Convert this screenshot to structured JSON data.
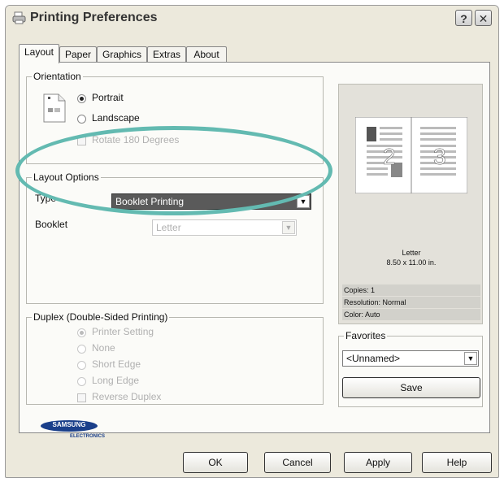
{
  "window": {
    "title": "Printing Preferences",
    "help_glyph": "?",
    "close_glyph": "✕"
  },
  "tabs": [
    {
      "label": "Layout",
      "active": true
    },
    {
      "label": "Paper",
      "active": false
    },
    {
      "label": "Graphics",
      "active": false
    },
    {
      "label": "Extras",
      "active": false
    },
    {
      "label": "About",
      "active": false
    }
  ],
  "orientation": {
    "legend": "Orientation",
    "portrait": "Portrait",
    "landscape": "Landscape",
    "rotate": "Rotate 180 Degrees",
    "selected": "portrait"
  },
  "layout_options": {
    "legend": "Layout Options",
    "type_label": "Type",
    "type_value": "Booklet Printing",
    "booklet_label": "Booklet",
    "booklet_value": "Letter"
  },
  "duplex": {
    "legend": "Duplex (Double-Sided Printing)",
    "printer_setting": "Printer Setting",
    "none": "None",
    "short_edge": "Short Edge",
    "long_edge": "Long Edge",
    "reverse": "Reverse Duplex"
  },
  "preview": {
    "page_left_number": "2",
    "page_right_number": "3",
    "paper_name": "Letter",
    "paper_size": "8.50 x 11.00 in.",
    "copies": "Copies: 1",
    "resolution": "Resolution: Normal",
    "color": "Color: Auto"
  },
  "favorites": {
    "legend": "Favorites",
    "value": "<Unnamed>",
    "save_label": "Save"
  },
  "logo": {
    "brand": "SAMSUNG",
    "sub": "ELECTRONICS",
    "color": "#1a3f8a"
  },
  "buttons": {
    "ok": "OK",
    "cancel": "Cancel",
    "apply": "Apply",
    "help": "Help"
  },
  "annotation_color": "#63bab1"
}
